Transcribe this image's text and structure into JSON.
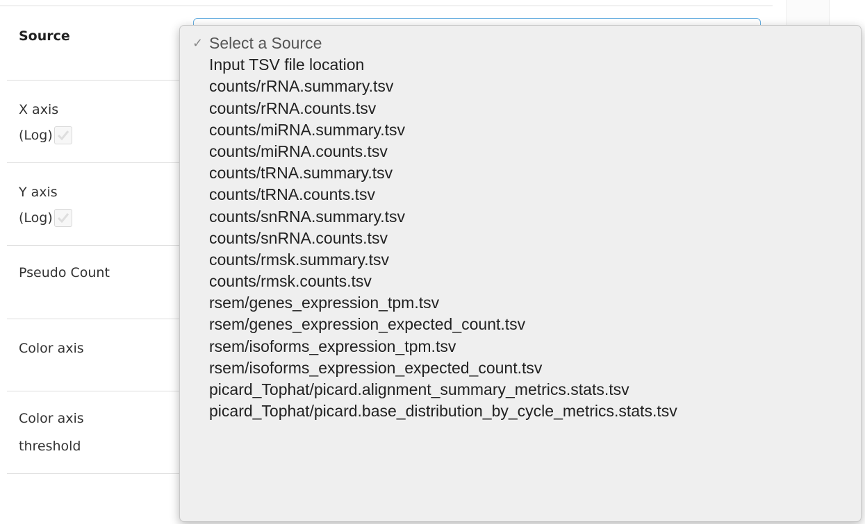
{
  "form": {
    "rows": [
      {
        "label": "Source"
      },
      {
        "label": "X axis",
        "sub": "(Log)"
      },
      {
        "label": "Y axis",
        "sub": "(Log)"
      },
      {
        "label": "Pseudo Count"
      },
      {
        "label": "Color axis"
      },
      {
        "label": "Color axis",
        "sub": "threshold"
      }
    ]
  },
  "dropdown": {
    "selected_mark": "✓",
    "options": [
      "Select a Source",
      "Input TSV file location",
      "counts/rRNA.summary.tsv",
      "counts/rRNA.counts.tsv",
      "counts/miRNA.summary.tsv",
      "counts/miRNA.counts.tsv",
      "counts/tRNA.summary.tsv",
      "counts/tRNA.counts.tsv",
      "counts/snRNA.summary.tsv",
      "counts/snRNA.counts.tsv",
      "counts/rmsk.summary.tsv",
      "counts/rmsk.counts.tsv",
      "rsem/genes_expression_tpm.tsv",
      "rsem/genes_expression_expected_count.tsv",
      "rsem/isoforms_expression_tpm.tsv",
      "rsem/isoforms_expression_expected_count.tsv",
      "picard_Tophat/picard.alignment_summary_metrics.stats.tsv",
      "picard_Tophat/picard.base_distribution_by_cycle_metrics.stats.tsv"
    ]
  },
  "colors": {
    "select_focus_border": "#66aee0",
    "dropdown_bg": "#efefef",
    "row_divider": "#dddddd"
  }
}
